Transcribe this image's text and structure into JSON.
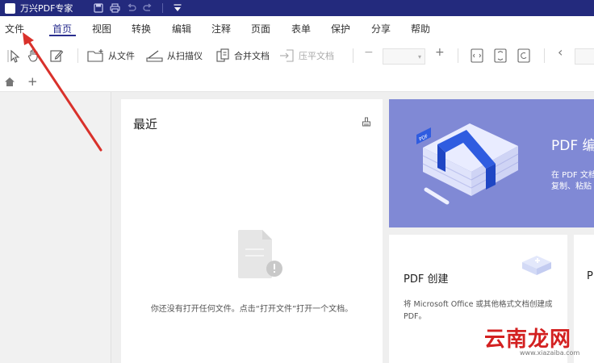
{
  "app": {
    "title": "万兴PDF专家"
  },
  "menu": {
    "items": [
      "文件",
      "首页",
      "视图",
      "转换",
      "编辑",
      "注释",
      "页面",
      "表单",
      "保护",
      "分享",
      "帮助"
    ],
    "active": "首页"
  },
  "toolbar": {
    "from_file": "从文件",
    "from_scanner": "从扫描仪",
    "merge": "合并文档",
    "flatten": "压平文档",
    "zoom_out": "−",
    "zoom_in": "+",
    "prev": "‹"
  },
  "tabs": {
    "new_tab": "+"
  },
  "recent": {
    "title": "最近",
    "empty_message": "你还没有打开任何文件。点击“打开文件”打开一个文档。"
  },
  "pdf_edit": {
    "title": "PDF 编",
    "desc_line1": "在 PDF 文档",
    "desc_line2": "复制、粘贴"
  },
  "pdf_create": {
    "title": "PDF 创建",
    "desc": "将 Microsoft Office 或其他格式文档创建成 PDF。"
  },
  "third_card": {
    "title": "P"
  },
  "watermark": {
    "text": "云南龙网",
    "sub": "www.xiazaiba.com"
  },
  "colors": {
    "titlebar": "#232a7d",
    "accent": "#2a2f8f",
    "banner": "#8089d5",
    "arrow": "#d9312b"
  }
}
